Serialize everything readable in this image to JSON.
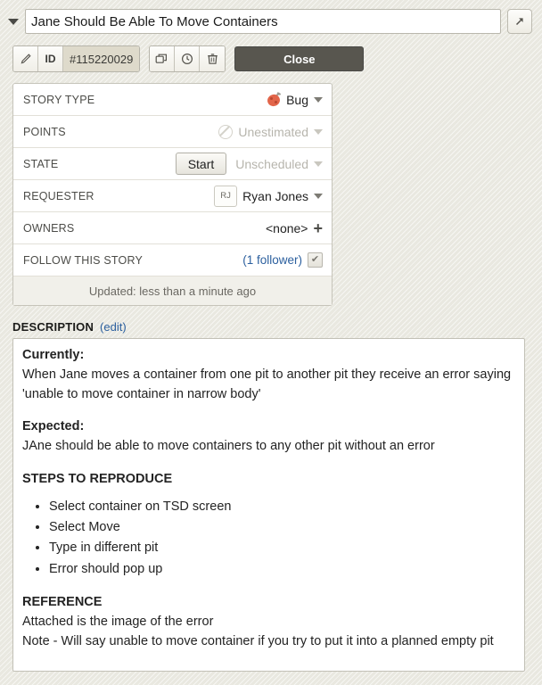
{
  "header": {
    "collapse_icon": "triangle-down-icon",
    "title_value": "Jane Should Be Able To Move Containers",
    "title_placeholder": "Story title",
    "expand_icon": "expand-arrow-icon"
  },
  "toolbar": {
    "edit_icon": "pencil-icon",
    "id_label": "ID",
    "id_value": "#115220029",
    "copy_icon": "duplicate-icon",
    "history_icon": "clock-icon",
    "delete_icon": "trash-icon",
    "close_label": "Close"
  },
  "attributes": {
    "story_type": {
      "label": "STORY TYPE",
      "value": "Bug",
      "icon": "bug-icon"
    },
    "points": {
      "label": "POINTS",
      "value": "Unestimated",
      "icon": "no-entry-icon"
    },
    "state": {
      "label": "STATE",
      "button": "Start",
      "value": "Unscheduled"
    },
    "requester": {
      "label": "REQUESTER",
      "initials": "RJ",
      "value": "Ryan Jones"
    },
    "owners": {
      "label": "OWNERS",
      "value": "<none>",
      "add_icon": "plus-icon"
    },
    "follow": {
      "label": "FOLLOW THIS STORY",
      "followers_link": "(1 follower)",
      "checked_glyph": "✔"
    },
    "footer": "Updated: less than a minute ago"
  },
  "description": {
    "section_label": "DESCRIPTION",
    "edit_label": "(edit)",
    "currently_heading": "Currently:",
    "currently_text": "When Jane moves a container from one pit to another pit they receive an error saying 'unable to move container in narrow body'",
    "expected_heading": "Expected:",
    "expected_text": "JAne should be able to move containers to any other pit without an error",
    "steps_heading": "STEPS TO REPRODUCE",
    "steps": [
      "Select container on TSD screen",
      "Select Move",
      "Type in different pit",
      "Error should pop up"
    ],
    "reference_heading": "REFERENCE",
    "reference_line1": "Attached is the image of the error",
    "reference_line2": "Note - Will say unable to move container if you try to put it into a planned empty pit"
  },
  "colors": {
    "background": "#ecebe3",
    "close_button": "#58564f",
    "link": "#2b5f9e",
    "bug": "#e2654a",
    "id_field": "#dedacb"
  }
}
